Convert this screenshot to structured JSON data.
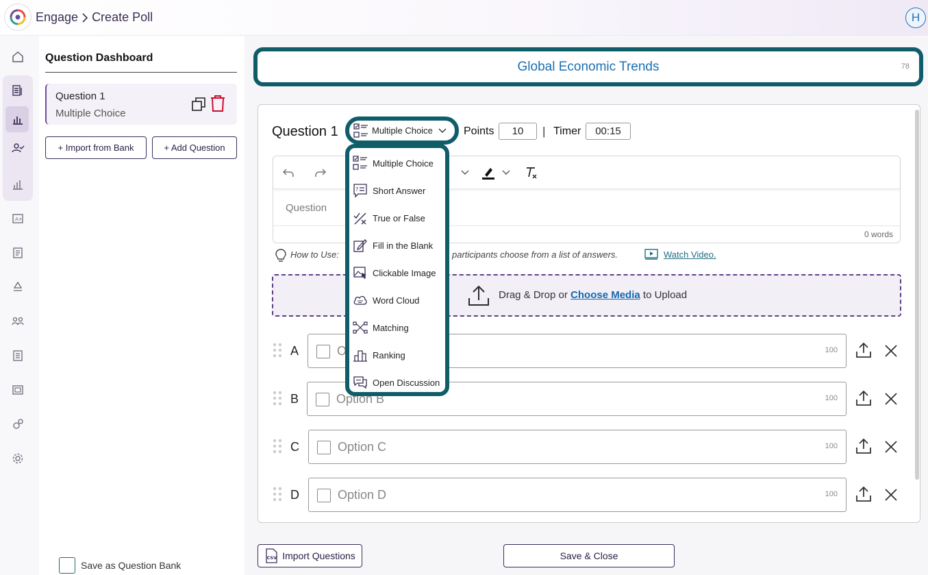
{
  "header": {
    "breadcrumb": [
      "Engage",
      "Create Poll"
    ],
    "avatar_initial": "H"
  },
  "sidebar": {
    "icons": [
      "home-icon",
      "document-list-icon",
      "bar-chart-icon",
      "user-check-icon",
      "analytics-icon",
      "grade-icon",
      "report-icon",
      "recycle-icon",
      "group-icon",
      "notes-icon",
      "gallery-icon",
      "gears-icon",
      "settings-icon"
    ]
  },
  "dashboard": {
    "title": "Question Dashboard",
    "questions": [
      {
        "title": "Question 1",
        "type": "Multiple Choice"
      }
    ],
    "import_label": "+ Import from Bank",
    "add_label": "+ Add Question",
    "save_bank_label": "Save as Question Bank"
  },
  "poll": {
    "title": "Global Economic Trends",
    "title_count": "78"
  },
  "question": {
    "label": "Question 1",
    "type": "Multiple Choice",
    "points_label": "Points",
    "points": "10",
    "separator": "|",
    "timer_label": "Timer",
    "timer": "00:15",
    "editor_placeholder": "Question",
    "word_count": "0 words",
    "howto_label": "How to Use:",
    "howto_text": "participants choose from a list of answers.",
    "watch_video": "Watch Video.",
    "upload_text_pre": "Drag & Drop or",
    "upload_link": "Choose Media",
    "upload_text_post": "to Upload"
  },
  "options": [
    {
      "letter": "A",
      "placeholder": "O",
      "count": "100"
    },
    {
      "letter": "B",
      "placeholder": "Option B",
      "count": "100"
    },
    {
      "letter": "C",
      "placeholder": "Option C",
      "count": "100"
    },
    {
      "letter": "D",
      "placeholder": "Option D",
      "count": "100"
    }
  ],
  "type_menu": {
    "items": [
      {
        "label": "Multiple Choice",
        "icon": "multiple-choice-icon"
      },
      {
        "label": "Short Answer",
        "icon": "short-answer-icon"
      },
      {
        "label": "True or False",
        "icon": "true-false-icon"
      },
      {
        "label": "Fill in the Blank",
        "icon": "fill-blank-icon"
      },
      {
        "label": "Clickable Image",
        "icon": "clickable-image-icon"
      },
      {
        "label": "Word Cloud",
        "icon": "word-cloud-icon"
      },
      {
        "label": "Matching",
        "icon": "matching-icon"
      },
      {
        "label": "Ranking",
        "icon": "ranking-icon"
      },
      {
        "label": "Open Discussion",
        "icon": "open-discussion-icon"
      }
    ]
  },
  "footer": {
    "import_label": "Import Questions",
    "csv_badge": "CSV",
    "save_label": "Save & Close"
  },
  "colors": {
    "accent": "#0f5d69",
    "brand_purple": "#3a2d5c",
    "link_blue": "#1268b0",
    "danger": "#c8102e"
  }
}
